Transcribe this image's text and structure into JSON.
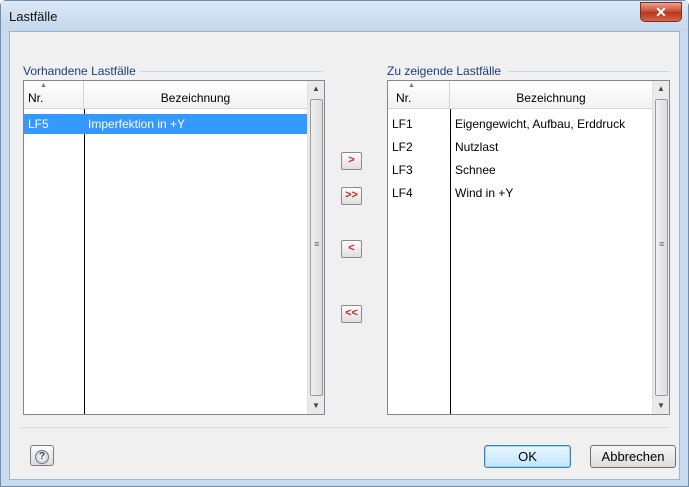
{
  "window": {
    "title": "Lastfälle",
    "close_glyph": "✕"
  },
  "left_list": {
    "group_label": "Vorhandene Lastfälle",
    "columns": [
      "Nr.",
      "Bezeichnung"
    ],
    "rows": [
      {
        "nr": "LF5",
        "name": "Imperfektion in +Y",
        "selected": true
      }
    ]
  },
  "right_list": {
    "group_label": "Zu zeigende Lastfälle",
    "columns": [
      "Nr.",
      "Bezeichnung"
    ],
    "rows": [
      {
        "nr": "LF1",
        "name": "Eigengewicht, Aufbau, Erddruck"
      },
      {
        "nr": "LF2",
        "name": "Nutzlast"
      },
      {
        "nr": "LF3",
        "name": "Schnee"
      },
      {
        "nr": "LF4",
        "name": "Wind in +Y"
      }
    ]
  },
  "move_buttons": {
    "add_one": ">",
    "add_all": ">>",
    "remove_one": "<",
    "remove_all": "<<"
  },
  "footer": {
    "help_icon": "?",
    "ok_label": "OK",
    "cancel_label": "Abbrechen"
  },
  "icons": {
    "sort": "sort-ascending-icon",
    "scroll_up": "scroll-up-icon",
    "scroll_down": "scroll-down-icon"
  },
  "colors": {
    "selection": "#3399ff",
    "group_label": "#1c3d7a",
    "move_arrows": "#d11f1f",
    "close_button": "#c9442a"
  }
}
